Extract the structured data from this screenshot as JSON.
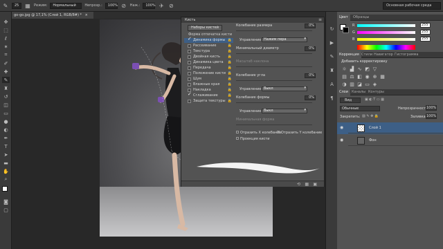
{
  "options_bar": {
    "brush_size": "25",
    "mode_label": "Режим:",
    "mode_value": "Нормальный",
    "opacity_label": "Непрозр.:",
    "opacity_value": "100%",
    "flow_label": "Наж.:",
    "flow_value": "100%",
    "workspace": "Основная рабочая среда"
  },
  "document": {
    "tab_title": "go-go.jpg @ 17,1% (Слой 1, RGB/8#) *",
    "close": "×"
  },
  "brush_panel": {
    "title": "Кисть",
    "presets_button": "Наборы кистей",
    "list_header": "Форма отпечатка кисти",
    "items": [
      {
        "label": "Динамика формы",
        "checked": true,
        "selected": true
      },
      {
        "label": "Рассеивание",
        "checked": false,
        "selected": false
      },
      {
        "label": "Текстура",
        "checked": false,
        "selected": false
      },
      {
        "label": "Двойная кисть",
        "checked": false,
        "selected": false
      },
      {
        "label": "Динамика цвета",
        "checked": false,
        "selected": false
      },
      {
        "label": "Передача",
        "checked": false,
        "selected": false
      },
      {
        "label": "Положение кисти",
        "checked": false,
        "selected": false
      },
      {
        "label": "Шум",
        "checked": false,
        "selected": false
      },
      {
        "label": "Влажные края",
        "checked": false,
        "selected": false
      },
      {
        "label": "Накладка",
        "checked": false,
        "selected": false
      },
      {
        "label": "Сглаживание",
        "checked": true,
        "selected": false
      },
      {
        "label": "Защита текстуры",
        "checked": false,
        "selected": false
      }
    ],
    "size_jitter_label": "Колебание размера",
    "size_jitter_value": "0%",
    "control_label": "Управление:",
    "control_size_value": "Нажим пера",
    "min_diameter_label": "Минимальный диаметр",
    "min_diameter_value": "0%",
    "tilt_scale_label": "Масштаб наклона",
    "angle_jitter_label": "Колебание угла",
    "angle_jitter_value": "0%",
    "control_angle_value": "Выкл",
    "roundness_jitter_label": "Колебание формы",
    "roundness_jitter_value": "0%",
    "control_round_value": "Выкл",
    "min_roundness_label": "Минимальная форма",
    "flip_x_label": "Отразить X колебание",
    "flip_y_label": "Отразить Y колебание",
    "projection_label": "Проекция кисти"
  },
  "color_panel": {
    "tabs": [
      "Цвет",
      "Образцы"
    ],
    "channels": [
      {
        "ch": "R",
        "value": "255"
      },
      {
        "ch": "G",
        "value": "255"
      },
      {
        "ch": "B",
        "value": "255"
      }
    ]
  },
  "adjustments_panel": {
    "tabs": [
      "Коррекция",
      "Стили",
      "Навигатор",
      "Гистограмма"
    ],
    "add_label": "Добавить корректировку"
  },
  "layers_panel": {
    "tabs": [
      "Слои",
      "Каналы",
      "Контуры"
    ],
    "kind_label": "Вид",
    "blend_mode": "Обычные",
    "opacity_label": "Непрозрачность:",
    "opacity_value": "100%",
    "lock_label": "Закрепить:",
    "fill_label": "Заливка:",
    "fill_value": "100%",
    "layers": [
      {
        "name": "Слой 1",
        "selected": true
      },
      {
        "name": "Фон",
        "selected": false
      }
    ]
  },
  "colors": {
    "ui_dark": "#3a3a3a",
    "panel": "#535353",
    "selection": "#3d5f86"
  }
}
